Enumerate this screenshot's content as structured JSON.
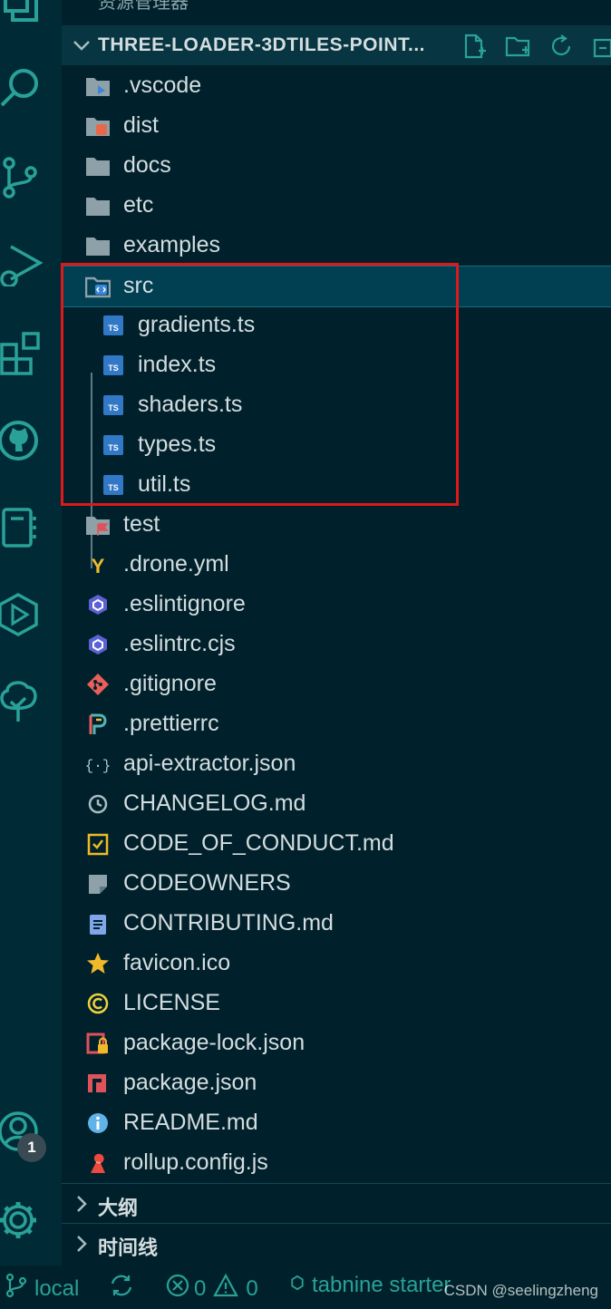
{
  "top_title": "资源管理器",
  "explorer": {
    "section_title": "THREE-LOADER-3DTILES-POINT...",
    "tool_icons": [
      "new-file-icon",
      "new-folder-icon",
      "refresh-icon",
      "collapse-all-icon"
    ]
  },
  "tree": [
    {
      "label": ".vscode",
      "icon": "folder-vscode-icon"
    },
    {
      "label": "dist",
      "icon": "folder-dist-icon"
    },
    {
      "label": "docs",
      "icon": "folder-icon"
    },
    {
      "label": "etc",
      "icon": "folder-icon"
    },
    {
      "label": "examples",
      "icon": "folder-icon"
    },
    {
      "label": "src",
      "icon": "folder-src-open-icon"
    },
    {
      "label": "gradients.ts",
      "icon": "typescript-icon"
    },
    {
      "label": "index.ts",
      "icon": "typescript-icon"
    },
    {
      "label": "shaders.ts",
      "icon": "typescript-icon"
    },
    {
      "label": "types.ts",
      "icon": "typescript-icon"
    },
    {
      "label": "util.ts",
      "icon": "typescript-icon"
    },
    {
      "label": "test",
      "icon": "folder-test-icon"
    },
    {
      "label": ".drone.yml",
      "icon": "yaml-icon"
    },
    {
      "label": ".eslintignore",
      "icon": "eslint-icon"
    },
    {
      "label": ".eslintrc.cjs",
      "icon": "eslint-icon"
    },
    {
      "label": ".gitignore",
      "icon": "git-icon"
    },
    {
      "label": ".prettierrc",
      "icon": "prettier-icon"
    },
    {
      "label": "api-extractor.json",
      "icon": "json-icon"
    },
    {
      "label": "CHANGELOG.md",
      "icon": "changelog-icon"
    },
    {
      "label": "CODE_OF_CONDUCT.md",
      "icon": "conduct-icon"
    },
    {
      "label": "CODEOWNERS",
      "icon": "codeowners-icon"
    },
    {
      "label": "CONTRIBUTING.md",
      "icon": "contributing-icon"
    },
    {
      "label": "favicon.ico",
      "icon": "star-icon"
    },
    {
      "label": "LICENSE",
      "icon": "license-icon"
    },
    {
      "label": "package-lock.json",
      "icon": "package-lock-icon"
    },
    {
      "label": "package.json",
      "icon": "npm-icon"
    },
    {
      "label": "README.md",
      "icon": "info-icon"
    },
    {
      "label": "rollup.config.js",
      "icon": "rollup-icon"
    }
  ],
  "panels": [
    {
      "label": "大纲"
    },
    {
      "label": "时间线"
    }
  ],
  "activity_bar": {
    "icons": [
      "explorer-icon",
      "search-icon",
      "source-control-icon",
      "run-debug-icon",
      "extensions-icon",
      "github-icon",
      "notebook-icon",
      "remote-icon",
      "tree-icon",
      "account-icon",
      "settings-gear-icon"
    ],
    "account_badge": "1"
  },
  "statusbar": {
    "branch": "local",
    "errors": "0",
    "warnings": "0",
    "tabnine": "tabnine starter"
  },
  "watermark": "CSDN @seelingzheng",
  "colors": {
    "background": "#00212b",
    "accent": "#2aa198",
    "highlight_box": "#e01818",
    "typescript": "#3178c6"
  }
}
